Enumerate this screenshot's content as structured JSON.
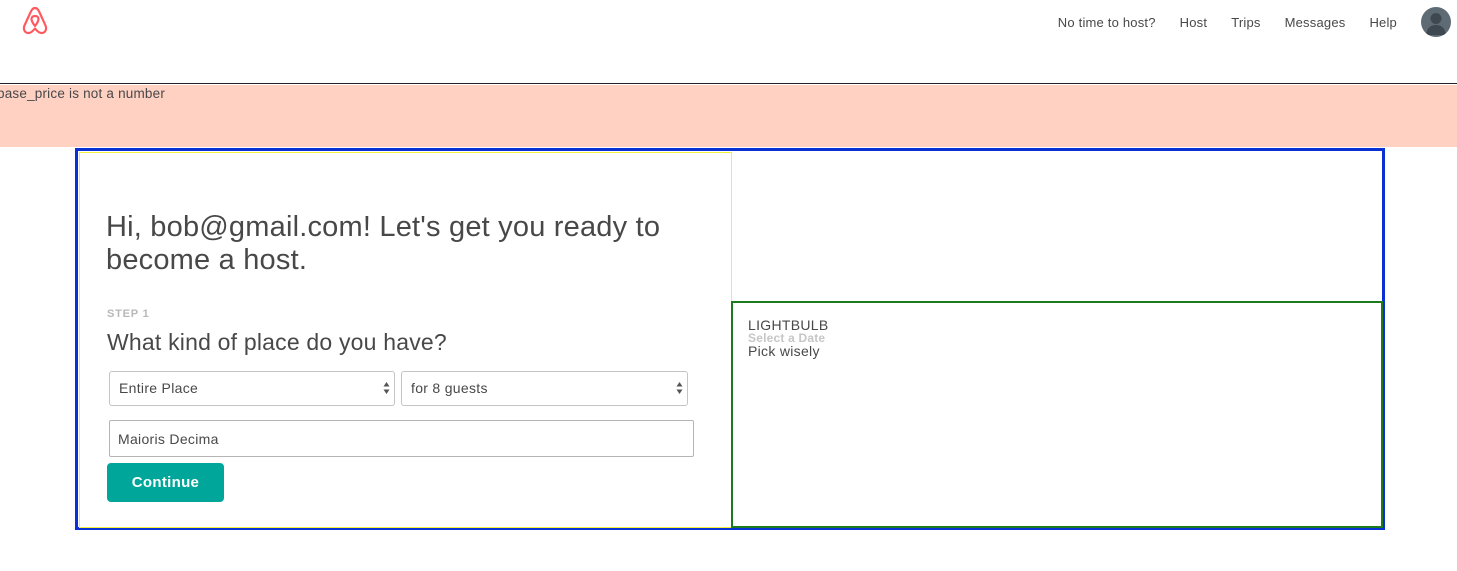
{
  "header": {
    "logo_icon": "airbnb-logo-icon",
    "brand_color": "#ff5a5f",
    "nav": {
      "no_time": "No time to host?",
      "host": "Host",
      "trips": "Trips",
      "messages": "Messages",
      "help": "Help"
    },
    "avatar_icon": "user-avatar-icon"
  },
  "error": {
    "message": "base_price is not a number",
    "background": "#ffd1c2"
  },
  "main": {
    "greeting": "Hi, bob@gmail.com! Let's get you ready to become a host.",
    "step_label": "STEP 1",
    "question": "What kind of place do you have?",
    "place_type": {
      "selected": "Entire Place"
    },
    "guests": {
      "selected": "for 8 guests"
    },
    "address_value": "Maioris Decima",
    "continue_label": "Continue",
    "accent_color": "#00a699"
  },
  "tip": {
    "title": "LIGHTBULB",
    "subtitle": "Select a Date",
    "body": "Pick wisely"
  }
}
